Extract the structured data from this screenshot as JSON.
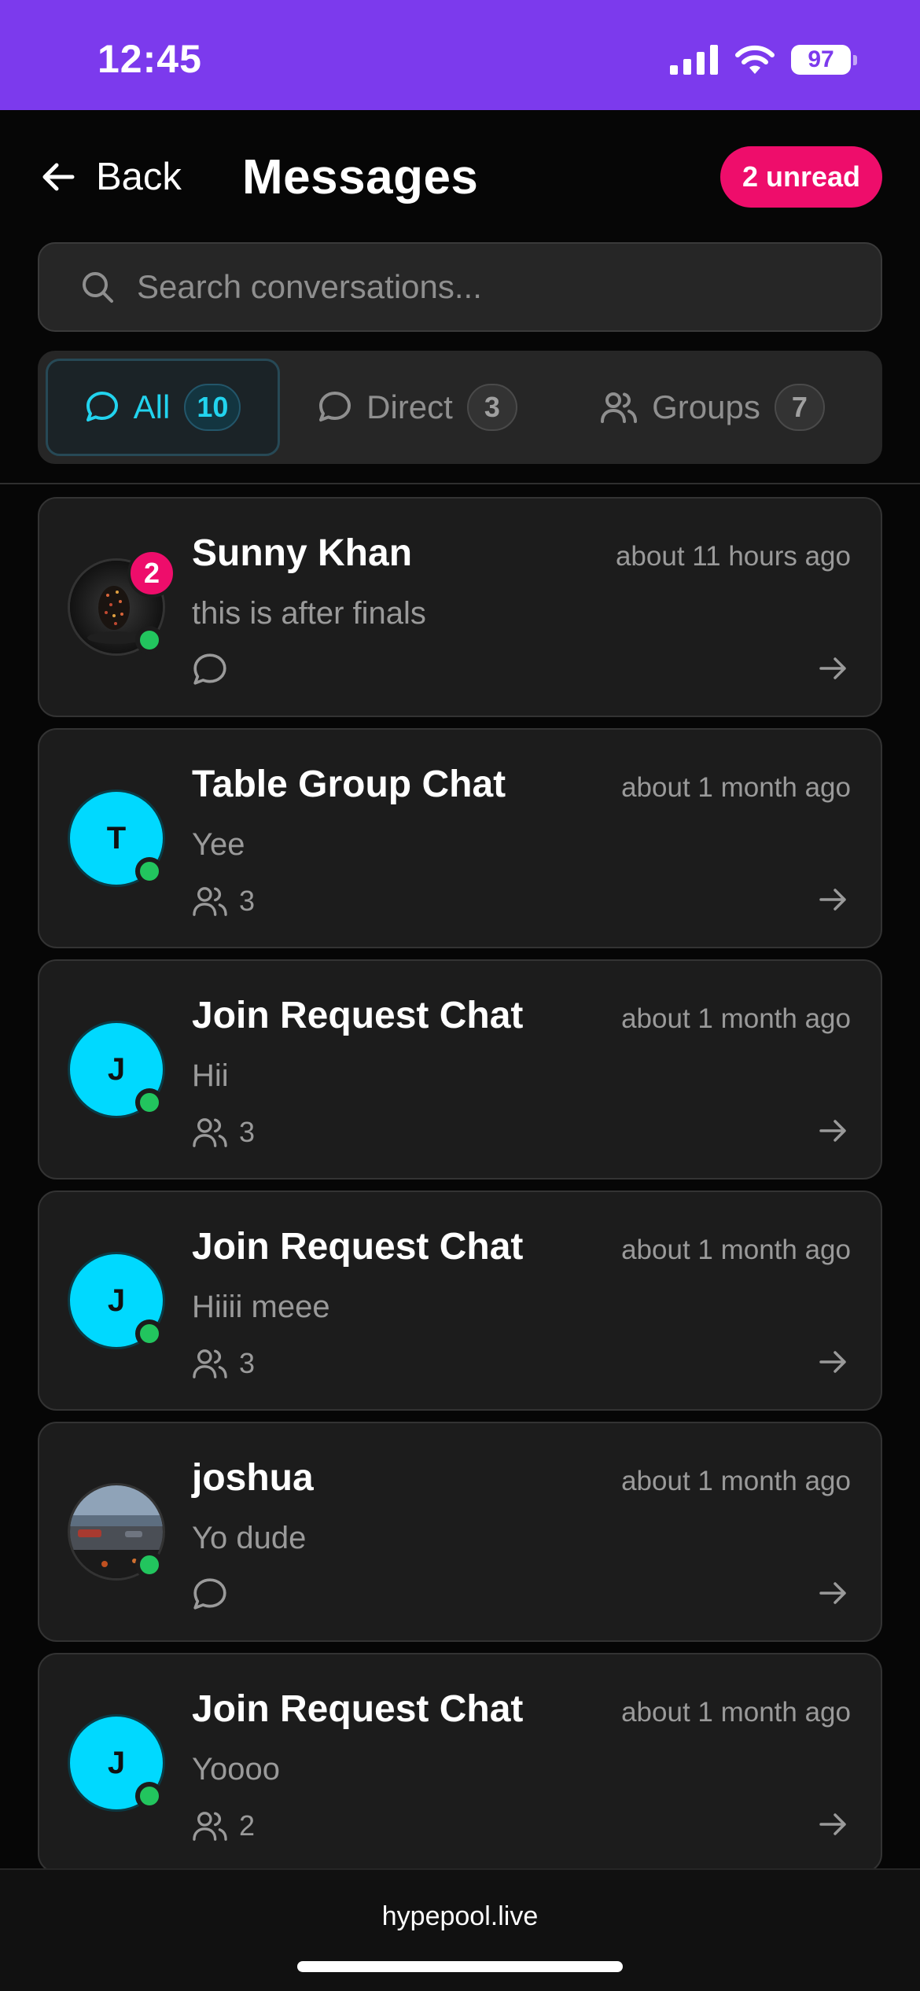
{
  "status_bar": {
    "time": "12:45",
    "battery": "97"
  },
  "header": {
    "back_label": "Back",
    "title": "Messages",
    "unread_badge": "2 unread"
  },
  "search": {
    "placeholder": "Search conversations..."
  },
  "tabs": [
    {
      "label": "All",
      "count": "10",
      "active": true,
      "icon": "chat-bubble-icon"
    },
    {
      "label": "Direct",
      "count": "3",
      "active": false,
      "icon": "chat-bubble-icon"
    },
    {
      "label": "Groups",
      "count": "7",
      "active": false,
      "icon": "users-icon"
    }
  ],
  "conversations": [
    {
      "name": "Sunny Khan",
      "time": "about 11 hours ago",
      "preview": "this is after finals",
      "type": "direct",
      "avatar": "photo-dark-orb",
      "unread": "2",
      "online": true
    },
    {
      "name": "Table Group Chat",
      "time": "about 1 month ago",
      "preview": "Yee",
      "type": "group",
      "members": "3",
      "avatar_initial": "T",
      "online": true
    },
    {
      "name": "Join Request Chat",
      "time": "about 1 month ago",
      "preview": "Hii",
      "type": "group",
      "members": "3",
      "avatar_initial": "J",
      "online": true
    },
    {
      "name": "Join Request Chat",
      "time": "about 1 month ago",
      "preview": "Hiiii meee",
      "type": "group",
      "members": "3",
      "avatar_initial": "J",
      "online": true
    },
    {
      "name": "joshua",
      "time": "about 1 month ago",
      "preview": "Yo dude",
      "type": "direct",
      "avatar": "photo-car-road",
      "online": true
    },
    {
      "name": "Join Request Chat",
      "time": "about 1 month ago",
      "preview": "Yoooo",
      "type": "group",
      "members": "2",
      "avatar_initial": "J",
      "online": true
    }
  ],
  "footer": {
    "url": "hypepool.live"
  },
  "colors": {
    "status_bar": "#7c3aed",
    "accent": "#22d3ee",
    "badge": "#ee0d6b",
    "online": "#22c55e",
    "avatar": "#00d9ff"
  }
}
